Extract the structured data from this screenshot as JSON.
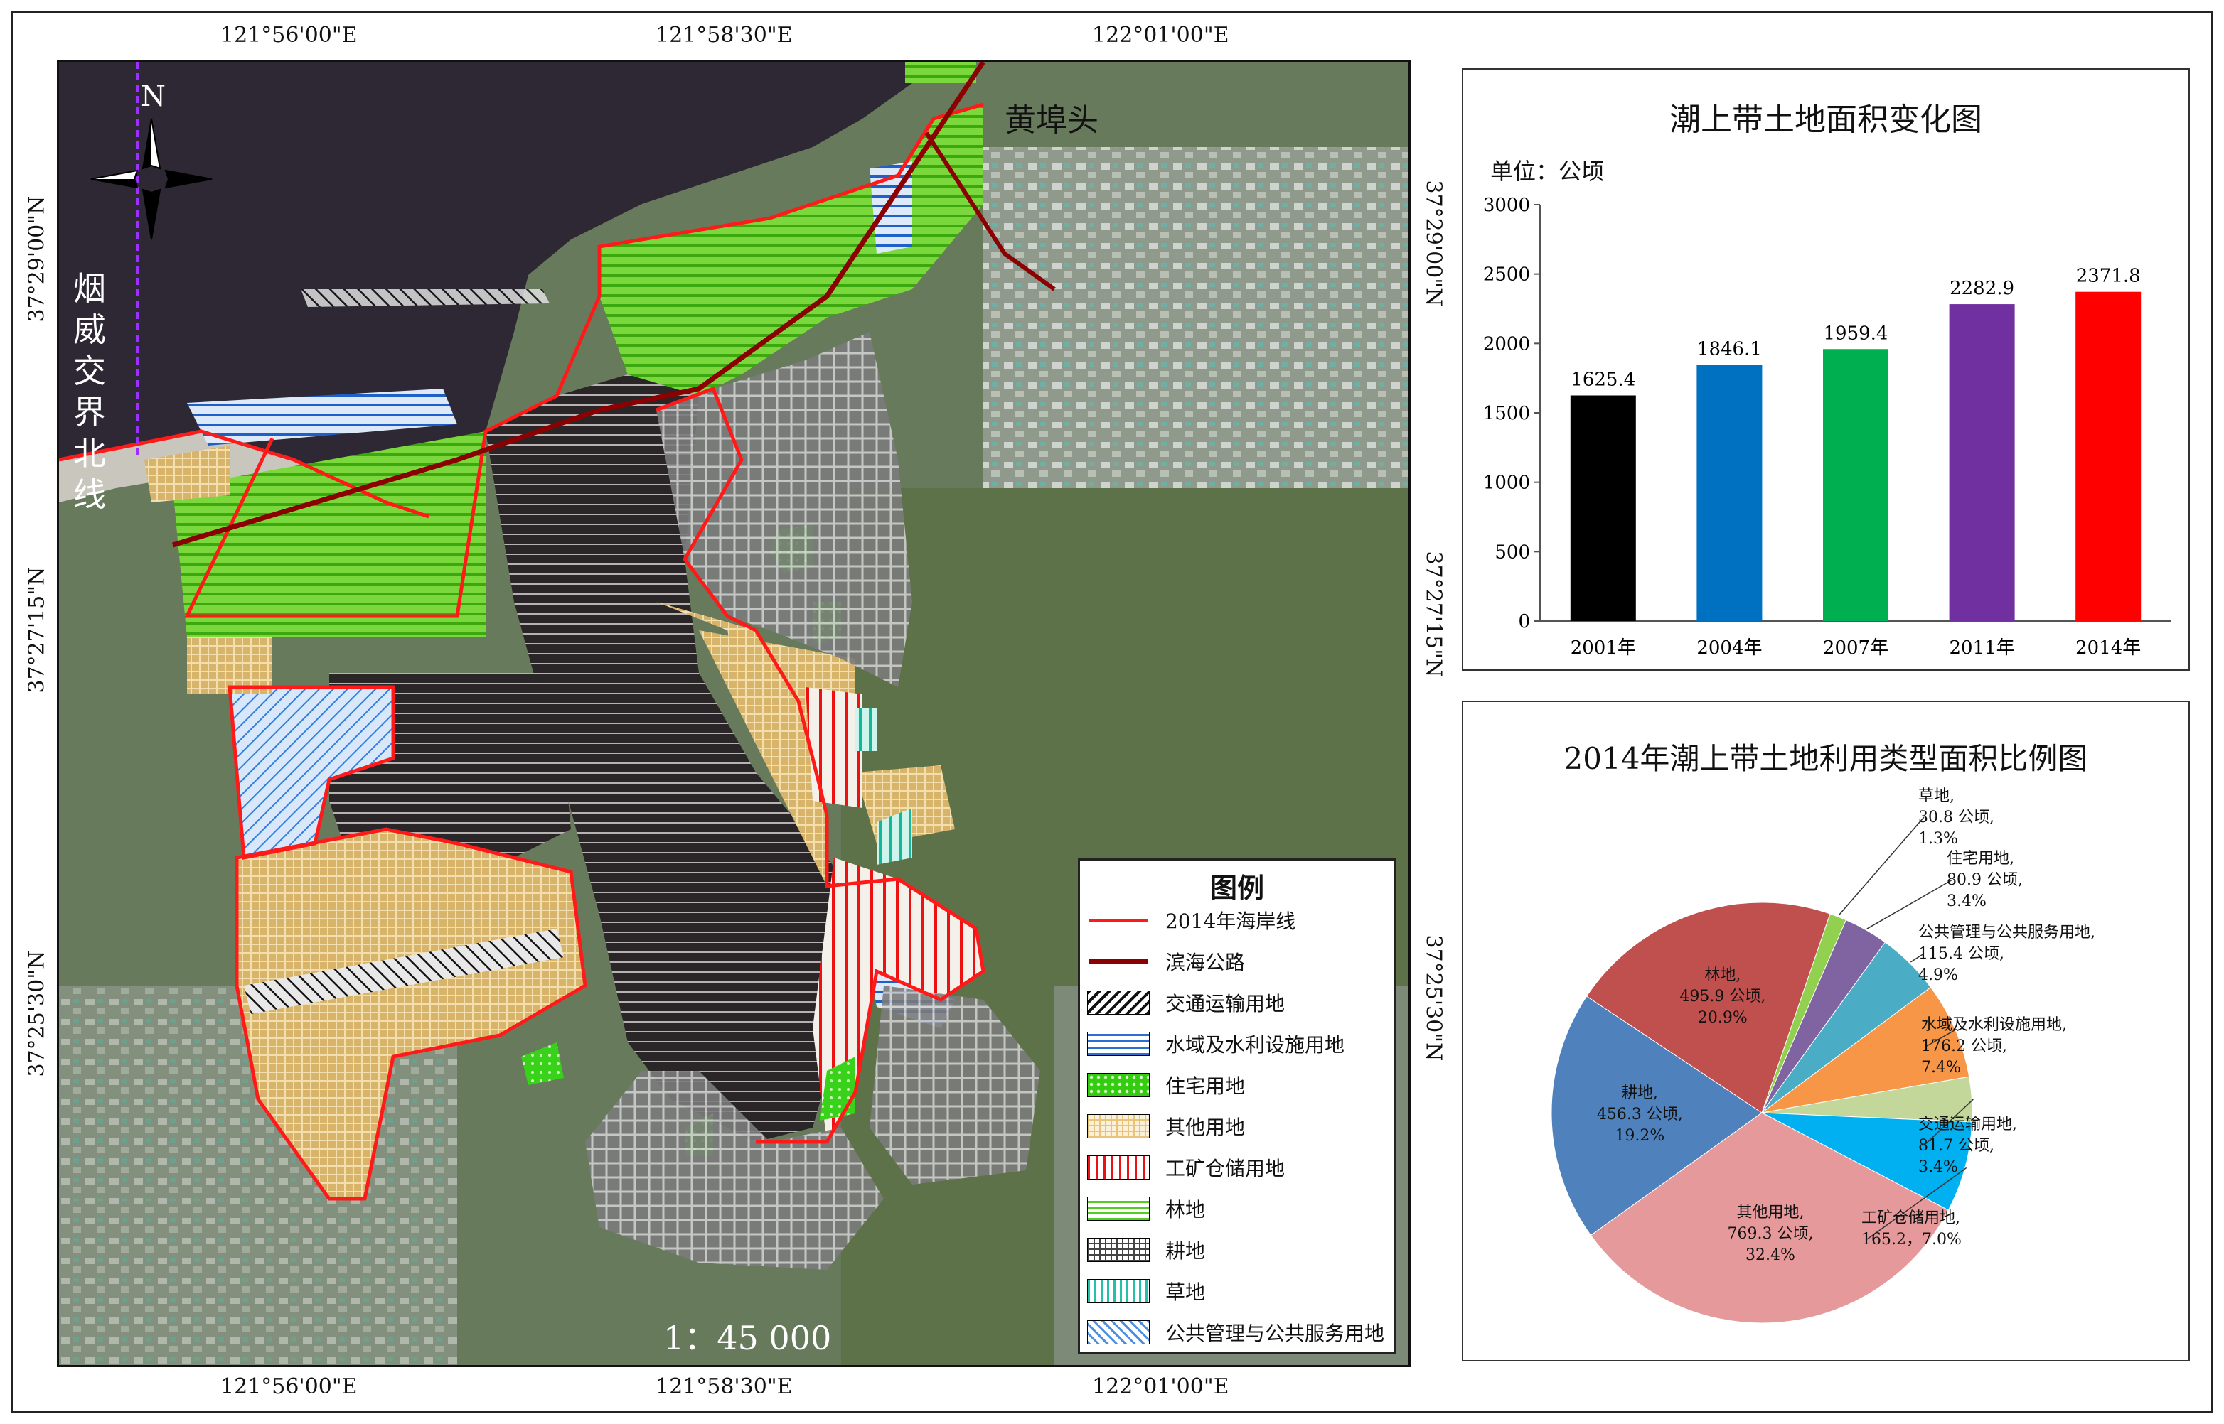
{
  "map": {
    "top_lon_labels": [
      "121°56'00\"E",
      "121°58'30\"E",
      "122°01'00\"E"
    ],
    "bottom_lon_labels": [
      "121°56'00\"E",
      "121°58'30\"E",
      "122°01'00\"E"
    ],
    "left_lat_labels": [
      "37°29'00\"N",
      "37°27'15\"N",
      "37°25'30\"N"
    ],
    "right_lat_labels": [
      "37°29'00\"N",
      "37°27'15\"N",
      "37°25'30\"N"
    ],
    "north_label": "N",
    "boundary_label": "烟威交界北线",
    "place_label": "黄埠头",
    "scale": "1：45 000"
  },
  "legend": {
    "title": "图例",
    "items": [
      {
        "label": "2014年海岸线",
        "color": "#ff1a1a"
      },
      {
        "label": "滨海公路",
        "color": "#8b0000"
      },
      {
        "label": "交通运输用地",
        "color": "#111111"
      },
      {
        "label": "水域及水利设施用地",
        "color": "#2a6fd6"
      },
      {
        "label": "住宅用地",
        "color": "#33cc11"
      },
      {
        "label": "其他用地",
        "color": "#e8c47a"
      },
      {
        "label": "工矿仓储用地",
        "color": "#ee1111"
      },
      {
        "label": "林地",
        "color": "#55cc22"
      },
      {
        "label": "耕地",
        "color": "#444444"
      },
      {
        "label": "草地",
        "color": "#22c2aa"
      },
      {
        "label": "公共管理与公共服务用地",
        "color": "#4a8fe0"
      }
    ]
  },
  "bar_chart": {
    "title": "潮上带土地面积变化图",
    "unit_label": "单位：公顷"
  },
  "pie_chart": {
    "title": "2014年潮上带土地利用类型面积比例图"
  },
  "chart_data": [
    {
      "type": "bar",
      "title": "潮上带土地面积变化图",
      "ylabel": "单位：公顷",
      "categories": [
        "2001年",
        "2004年",
        "2007年",
        "2011年",
        "2014年"
      ],
      "values": [
        1625.4,
        1846.1,
        1959.4,
        2282.9,
        2371.8
      ],
      "value_labels": [
        "1625.4",
        "1846.1",
        "1959.4",
        "2282.9",
        "2371.8"
      ],
      "colors": [
        "#000000",
        "#0070c0",
        "#00b050",
        "#7030a0",
        "#ff0000"
      ],
      "ylim": [
        0,
        3000
      ],
      "yticks": [
        "0",
        "500",
        "1000",
        "1500",
        "2000",
        "2500",
        "3000"
      ]
    },
    {
      "type": "pie",
      "title": "2014年潮上带土地利用类型面积比例图",
      "slices": [
        {
          "name": "草地",
          "value": 30.8,
          "percent": 1.3,
          "color": "#92d050",
          "label_lines": [
            "草地,",
            "30.8 公顷,",
            "1.3%"
          ]
        },
        {
          "name": "住宅用地",
          "value": 80.9,
          "percent": 3.4,
          "color": "#8064a2",
          "label_lines": [
            "住宅用地,",
            "80.9 公顷,",
            "3.4%"
          ]
        },
        {
          "name": "公共管理与公共服务用地",
          "value": 115.4,
          "percent": 4.9,
          "color": "#4bacc6",
          "label_lines": [
            "公共管理与公共服务用地,",
            "115.4 公顷,",
            "4.9%"
          ]
        },
        {
          "name": "水域及水利设施用地",
          "value": 176.2,
          "percent": 7.4,
          "color": "#f79646",
          "label_lines": [
            "水域及水利设施用地,",
            "176.2 公顷,",
            "7.4%"
          ]
        },
        {
          "name": "交通运输用地",
          "value": 81.7,
          "percent": 3.4,
          "color": "#c4d79b",
          "label_lines": [
            "交通运输用地,",
            "81.7 公顷,",
            "3.4%"
          ]
        },
        {
          "name": "工矿仓储用地",
          "value": 165.2,
          "percent": 7.0,
          "color": "#00b0f0",
          "label_lines": [
            "工矿仓储用地,",
            "165.2，7.0%"
          ]
        },
        {
          "name": "其他用地",
          "value": 769.3,
          "percent": 32.4,
          "color": "#e6999a",
          "label_lines": [
            "其他用地,",
            "769.3 公顷,",
            "32.4%"
          ]
        },
        {
          "name": "耕地",
          "value": 456.3,
          "percent": 19.2,
          "color": "#4f81bd",
          "label_lines": [
            "耕地,",
            "456.3 公顷,",
            "19.2%"
          ]
        },
        {
          "name": "林地",
          "value": 495.9,
          "percent": 20.9,
          "color": "#c0504d",
          "label_lines": [
            "林地,",
            "495.9 公顷,",
            "20.9%"
          ]
        }
      ]
    }
  ]
}
